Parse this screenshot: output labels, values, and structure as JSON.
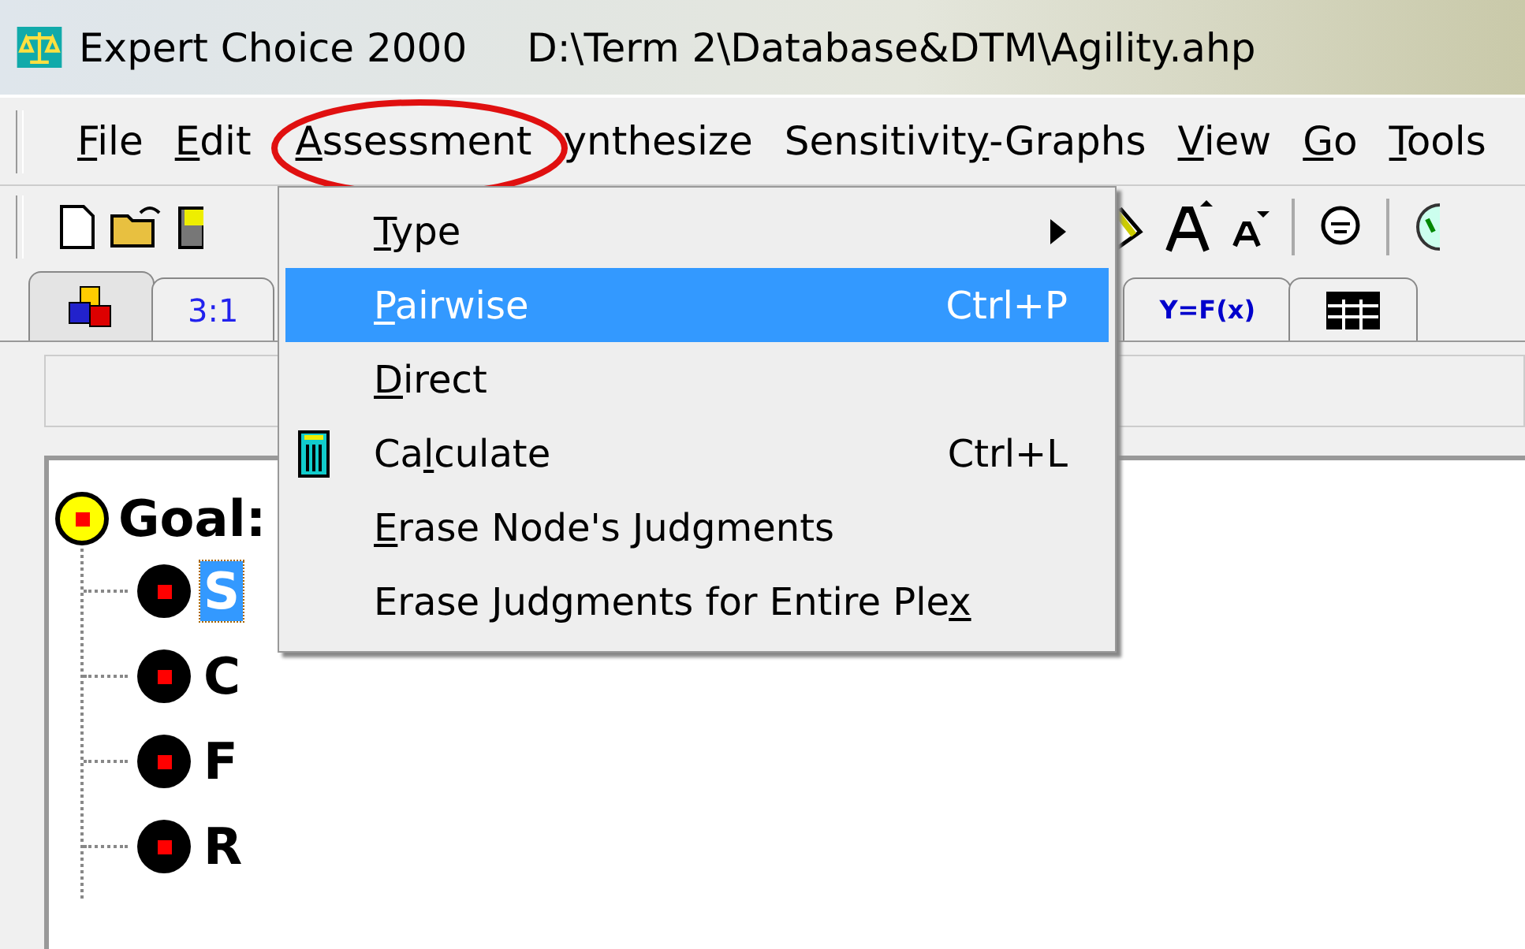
{
  "window": {
    "title": "Expert Choice 2000",
    "path": "D:\\Term 2\\Database&DTM\\Agility.ahp"
  },
  "menu_bar": [
    {
      "key": "F",
      "post": "ile"
    },
    {
      "key": "E",
      "post": "dit"
    },
    {
      "key": "A",
      "post": "ssessment"
    },
    {
      "post": "ynthesize"
    },
    {
      "pre": "Sensitivit",
      "key": "y",
      "post": "-Graphs"
    },
    {
      "key": "V",
      "post": "iew"
    },
    {
      "key": "G",
      "post": "o"
    },
    {
      "key": "T",
      "post": "ools"
    }
  ],
  "tabs": [
    {
      "kind": "cubes",
      "selected": true
    },
    {
      "kind": "text",
      "label": "3:1",
      "selected": false
    },
    {
      "kind": "formula",
      "label": "Y=F(x)",
      "selected": false
    },
    {
      "kind": "grid",
      "selected": false
    }
  ],
  "dropdown": [
    {
      "key": "T",
      "post": "ype",
      "submenu": true,
      "icon": false,
      "selected": false
    },
    {
      "key": "P",
      "post": "airwise",
      "shortcut": "Ctrl+P",
      "submenu": false,
      "icon": false,
      "selected": true
    },
    {
      "key": "D",
      "post": "irect",
      "submenu": false,
      "icon": false,
      "selected": false
    },
    {
      "pre": "Ca",
      "key": "l",
      "post": "culate",
      "shortcut": "Ctrl+L",
      "submenu": false,
      "icon": true,
      "selected": false
    },
    {
      "key": "E",
      "post": "rase Node's Judgments",
      "submenu": false,
      "icon": false,
      "selected": false
    },
    {
      "pre": "Erase Judgments for Entire Ple",
      "key": "x",
      "submenu": false,
      "icon": false,
      "selected": false
    }
  ],
  "tree": {
    "label": "Goal:",
    "children": [
      {
        "label": "S",
        "selected": true
      },
      {
        "label": "C",
        "selected": false
      },
      {
        "label": "F",
        "selected": false
      },
      {
        "label": "R",
        "selected": false
      }
    ]
  }
}
